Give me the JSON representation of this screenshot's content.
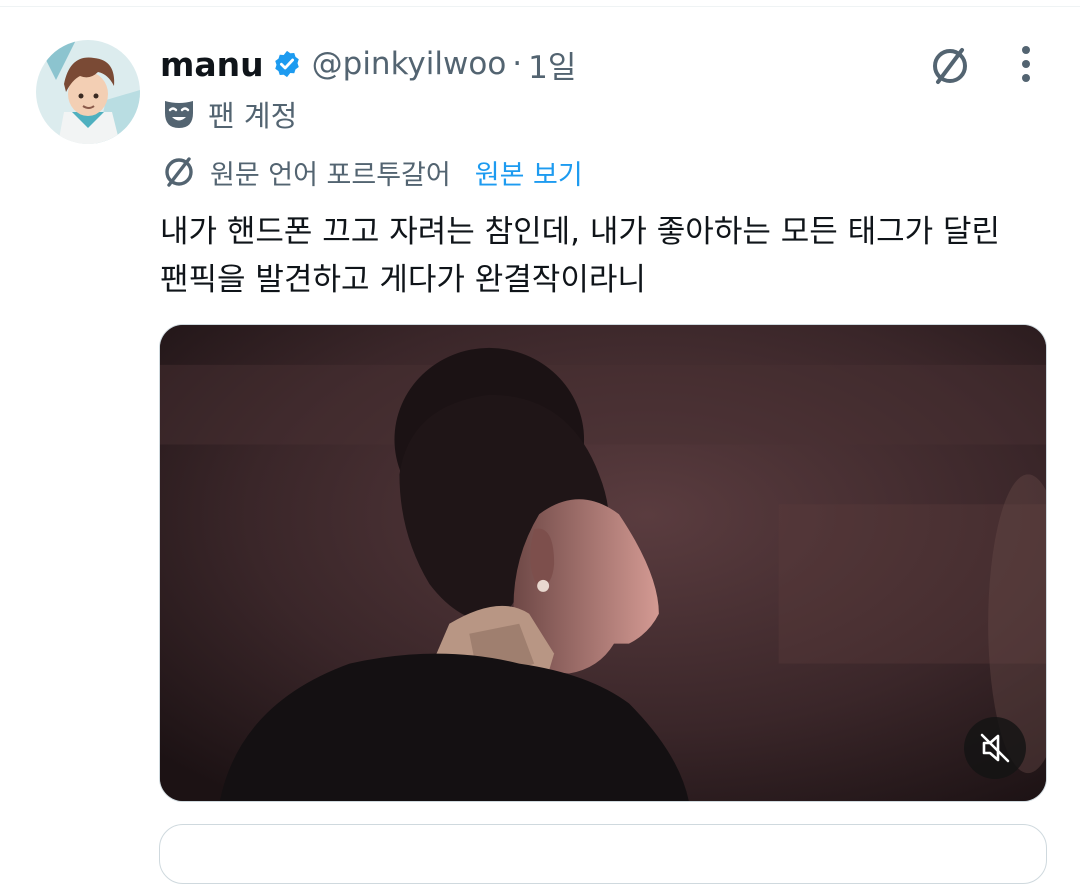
{
  "tweet": {
    "display_name": "manu",
    "handle": "@pinkyilwoo",
    "separator": "·",
    "time": "1일",
    "badge_label": "팬 계정",
    "translation": {
      "note": "원문 언어 포르투갈어",
      "view_original": "원본 보기"
    },
    "text_lines": [
      "내가 핸드폰 끄고 자려는 참인데, 내가 좋아하는 모든 태그가 달린",
      "팬픽을 발견하고 게다가 완결작이라니"
    ]
  },
  "icons": {
    "verified": "verified-badge-icon",
    "translate": "translate-icon",
    "more": "more-options-icon",
    "fan_badge": "theater-mask-icon",
    "mute": "muted-speaker-icon"
  },
  "colors": {
    "accent": "#1d9bf0",
    "secondary_text": "#536471",
    "primary_text": "#0f1419"
  }
}
